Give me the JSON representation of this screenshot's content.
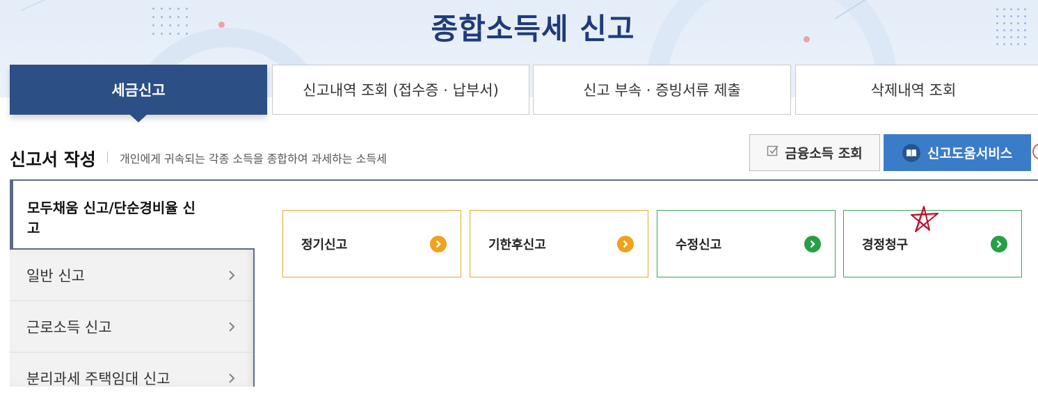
{
  "page": {
    "title": "종합소득세 신고",
    "colors": {
      "primary": "#2c4f86",
      "accent": "#3b7cc9",
      "orange": "#f0a21d",
      "green": "#26a047"
    }
  },
  "tabs": [
    {
      "label": "세금신고",
      "active": true
    },
    {
      "label": "신고내역 조회 (접수증 · 납부서)",
      "active": false
    },
    {
      "label": "신고 부속 · 증빙서류 제출",
      "active": false
    },
    {
      "label": "삭제내역 조회",
      "active": false
    }
  ],
  "section": {
    "title": "신고서 작성",
    "description": "개인에게 귀속되는 각종 소득을 종합하여 과세하는 소득세"
  },
  "actions": {
    "financial_income": {
      "label": "금융소득 조회",
      "icon": "checkbox-edit-icon"
    },
    "filing_help": {
      "label": "신고도움서비스",
      "icon": "book-icon"
    }
  },
  "side_menu": [
    {
      "label": "모두채움 신고/단순경비율 신고",
      "active": true
    },
    {
      "label": "일반 신고",
      "active": false,
      "icon": "chevron-right-icon"
    },
    {
      "label": "근로소득 신고",
      "active": false,
      "icon": "chevron-right-icon"
    },
    {
      "label": "분리과세 주택임대 신고",
      "active": false,
      "icon": "chevron-right-icon"
    }
  ],
  "cards": [
    {
      "label": "정기신고",
      "color": "orange",
      "icon": "arrow-right-circle-icon"
    },
    {
      "label": "기한후신고",
      "color": "orange",
      "icon": "arrow-right-circle-icon"
    },
    {
      "label": "수정신고",
      "color": "green",
      "icon": "arrow-right-circle-icon"
    },
    {
      "label": "경정청구",
      "color": "green",
      "icon": "arrow-right-circle-icon"
    }
  ]
}
